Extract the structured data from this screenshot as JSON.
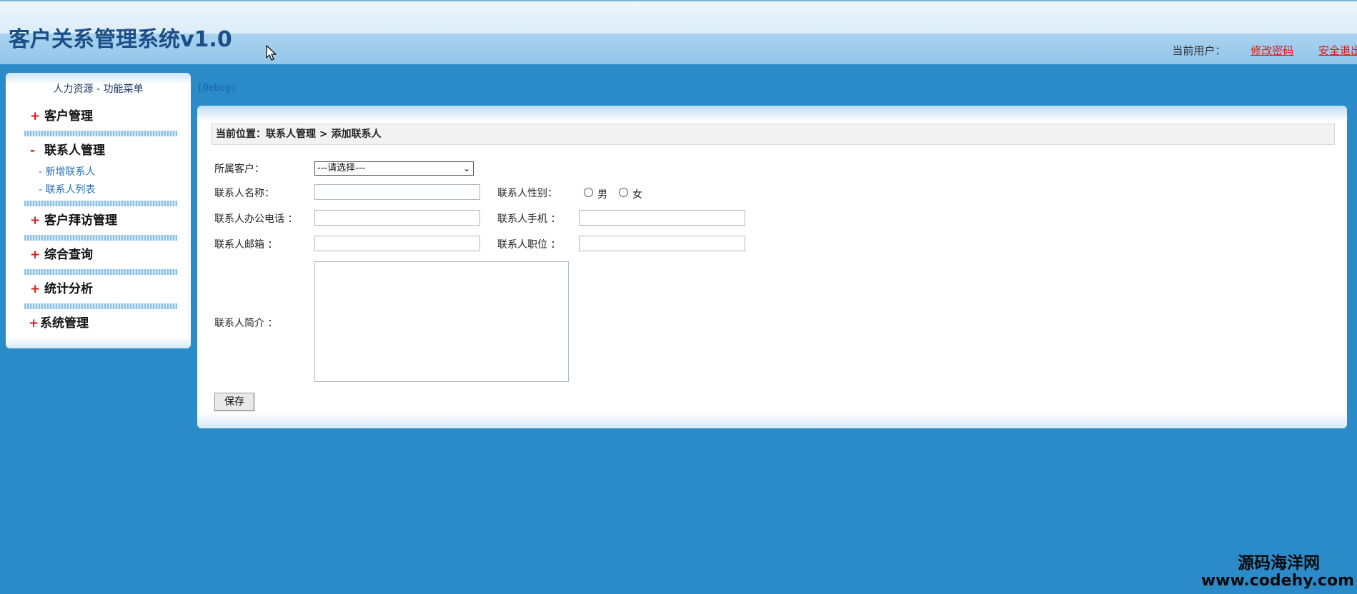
{
  "header": {
    "app_title": "客户关系管理系统v1.0",
    "current_user_label": "当前用户：",
    "change_password": "修改密码",
    "logout": "安全退出"
  },
  "sidebar": {
    "title": "人力资源  - 功能菜单",
    "groups": [
      {
        "sign": "+",
        "label": "客户管理"
      },
      {
        "sign": "-",
        "label": "联系人管理",
        "items": [
          "-  新增联系人",
          "- 联系人列表"
        ]
      },
      {
        "sign": "+",
        "label": "客户拜访管理"
      },
      {
        "sign": "+",
        "label": "综合查询"
      },
      {
        "sign": "+",
        "label": "统计分析"
      },
      {
        "sign": "+",
        "label": "系统管理"
      }
    ]
  },
  "debug": "[Debug]",
  "main": {
    "breadcrumb": "当前位置：联系人管理  >  添加联系人",
    "form": {
      "customer_label": "所属客户：",
      "customer_select_value": "---请选择---",
      "name_label": "联系人名称：",
      "gender_label": "联系人性别：",
      "gender_male": "男",
      "gender_female": "女",
      "office_phone_label": "联系人办公电话 ：",
      "mobile_label": "联系人手机 ：",
      "email_label": "联系人邮箱 ：",
      "position_label": "联系人职位 ：",
      "intro_label": "联系人简介 ：",
      "save_label": "保存"
    }
  },
  "watermark": {
    "line1": "源码海洋网",
    "line2": "www.codehy.com"
  }
}
